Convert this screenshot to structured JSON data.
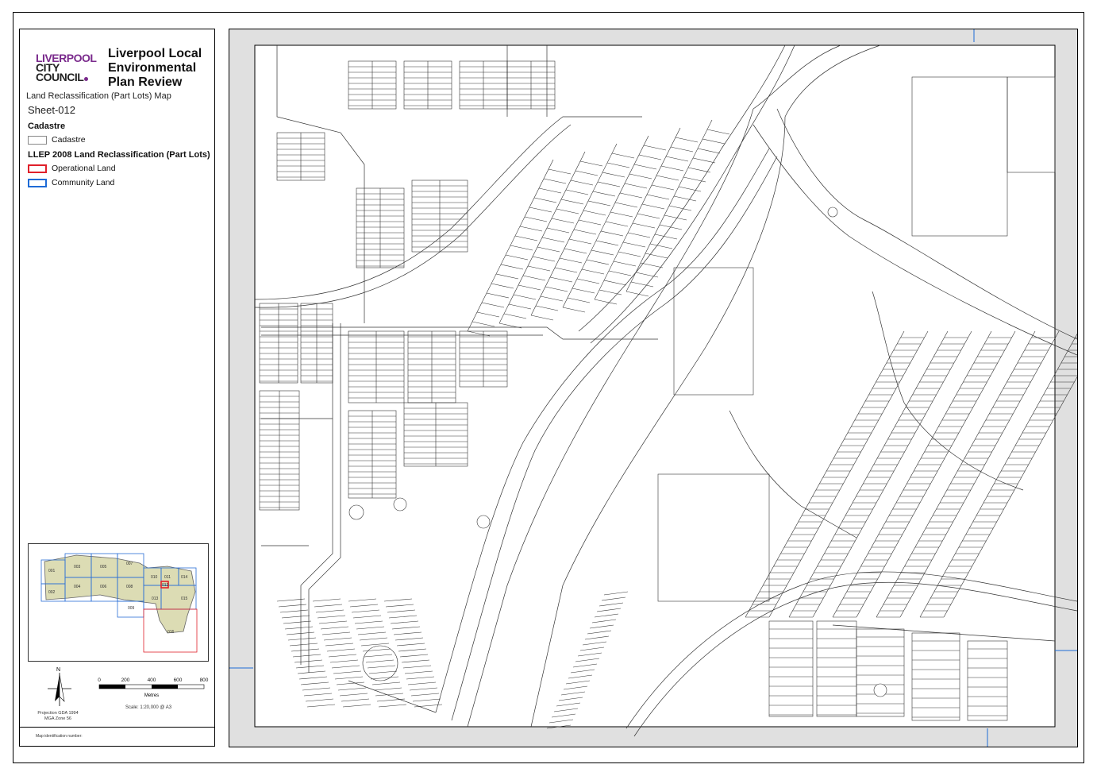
{
  "logo": {
    "line1": "LIVERPOOL",
    "line2": "CITY",
    "line3": "COUNCIL"
  },
  "title": "Liverpool Local Environmental Plan Review",
  "subtitle": "Land  Reclassification (Part Lots) Map",
  "sheet": "Sheet-012",
  "legend": {
    "section1": "Cadastre",
    "item_cadastre": "Cadastre",
    "section2": "LLEP 2008 Land  Reclassification (Part Lots)",
    "item_operational": "Operational Land",
    "item_community": "Community Land"
  },
  "inset": {
    "tiles": [
      "001",
      "002",
      "003",
      "004",
      "005",
      "006",
      "007",
      "008",
      "009",
      "010",
      "011",
      "012",
      "013",
      "014",
      "015",
      "016"
    ]
  },
  "north_label": "N",
  "scale": {
    "ticks": [
      "0",
      "200",
      "400",
      "600",
      "800"
    ],
    "unit": "Metres",
    "text": "Scale: 1:20,000 @ A3"
  },
  "projection": "Projection GDA 1994 MGA Zone 56",
  "map_id_label": "Map identification number:",
  "colors": {
    "operational": "#e0202a",
    "community": "#1e6bd6",
    "inset_fill": "#dcdcb4",
    "grey": "#e0e0e0"
  }
}
